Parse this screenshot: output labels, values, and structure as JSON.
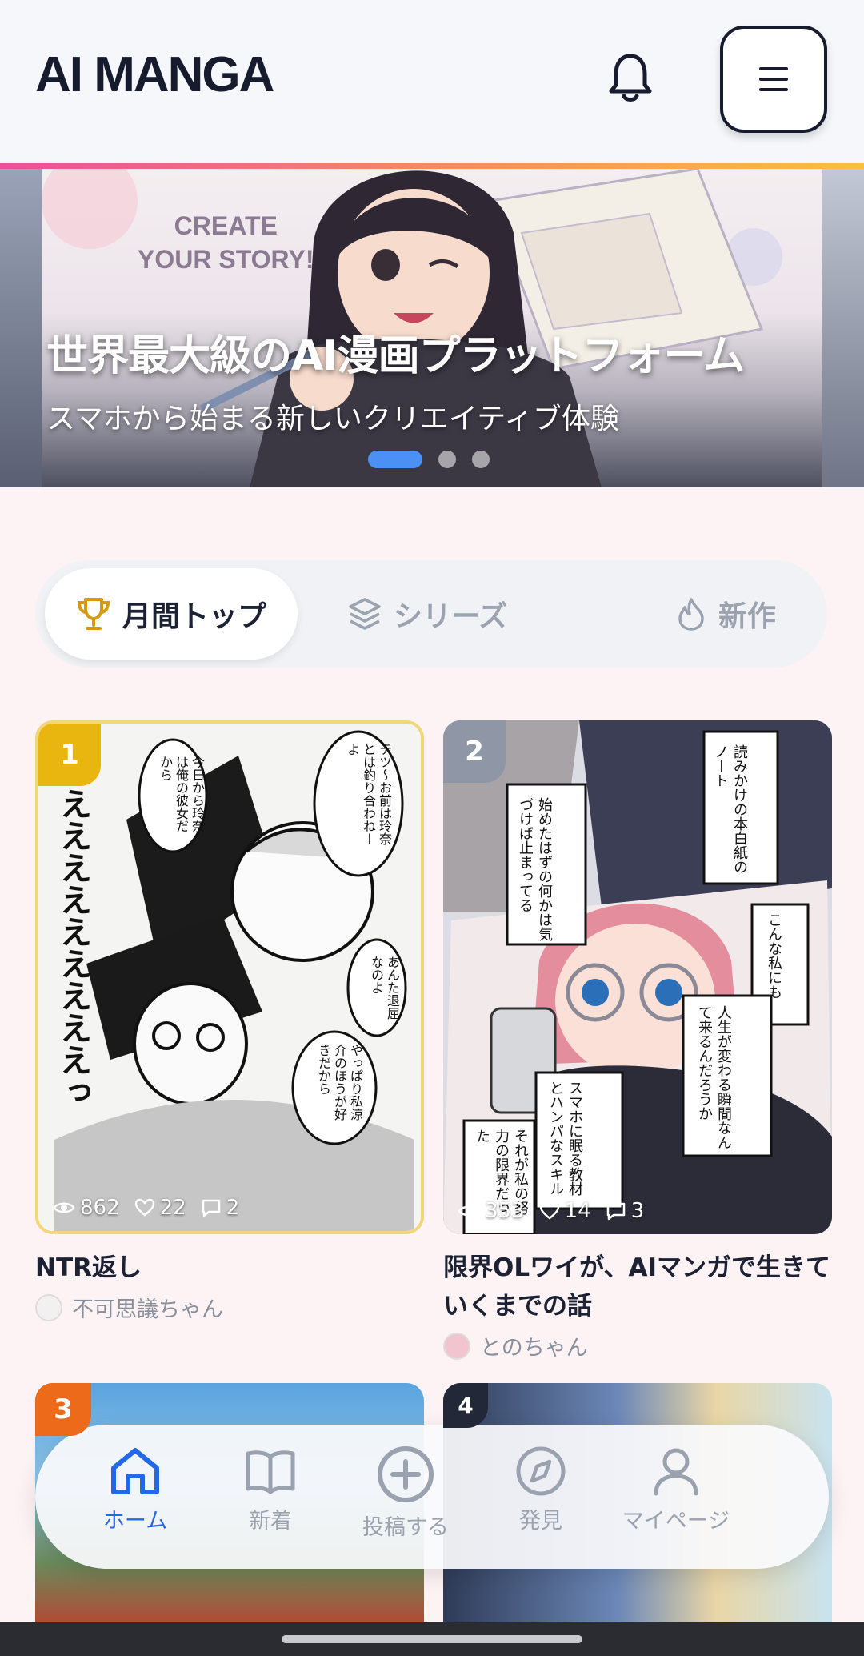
{
  "header": {
    "logo": "AI MANGA",
    "bell_icon": "bell-icon",
    "menu_icon": "hamburger-menu-icon"
  },
  "hero": {
    "art_text_line1": "CREATE",
    "art_text_line2": "YOUR STORY!",
    "title": "世界最大級のAI漫画プラットフォーム",
    "subtitle": "スマホから始まる新しいクリエイティブ体験",
    "slide_count": 3,
    "active_slide": 1
  },
  "tabs": [
    {
      "label": "月間トップ",
      "icon": "trophy-icon",
      "active": true
    },
    {
      "label": "シリーズ",
      "icon": "layers-icon",
      "active": false
    },
    {
      "label": "新作",
      "icon": "flame-icon",
      "active": false
    }
  ],
  "cards": [
    {
      "rank": "1",
      "rank_color": "#e9b610",
      "views": "862",
      "likes": "22",
      "comments": "2",
      "title": "NTR返し",
      "author": "不可思議ちゃん",
      "bubbles": [
        "テツ〜お前は玲奈とは釣り合わねーよ",
        "今日から玲奈は俺の彼女だから",
        "あんた退屈なのよ",
        "やっぱり私涼介のほうが好きだから",
        "えええええええええっ"
      ]
    },
    {
      "rank": "2",
      "rank_color": "#8f96a6",
      "views": "353",
      "likes": "14",
      "comments": "3",
      "title": "限界OLワイが、AIマンガで生きていくまでの話",
      "author": "とのちゃん",
      "bubbles": [
        "読みかけの本白紙のノート",
        "始めたはずの何かは気づけば止まってる",
        "こんな私にも",
        "人生が変わる瞬間なんて来るんだろうか",
        "スマホに眠る教材とハンパなスキル",
        "それが私の努力の限界だった"
      ]
    },
    {
      "rank": "3",
      "rank_color": "#ec6a1a"
    },
    {
      "rank": "4",
      "rank_color": "#222838"
    }
  ],
  "bottom_nav": [
    {
      "label": "ホーム",
      "icon": "home-icon",
      "active": true
    },
    {
      "label": "新着",
      "icon": "book-open-icon",
      "active": false
    },
    {
      "label": "投稿する",
      "icon": "plus-circle-icon",
      "active": false
    },
    {
      "label": "発見",
      "icon": "compass-icon",
      "active": false
    },
    {
      "label": "マイページ",
      "icon": "user-icon",
      "active": false
    }
  ],
  "colors": {
    "accent": "#2468e8",
    "header_gradient": [
      "#ec4f9b",
      "#f28a66",
      "#f5c23b"
    ],
    "card1_border": "#f2d77a"
  }
}
